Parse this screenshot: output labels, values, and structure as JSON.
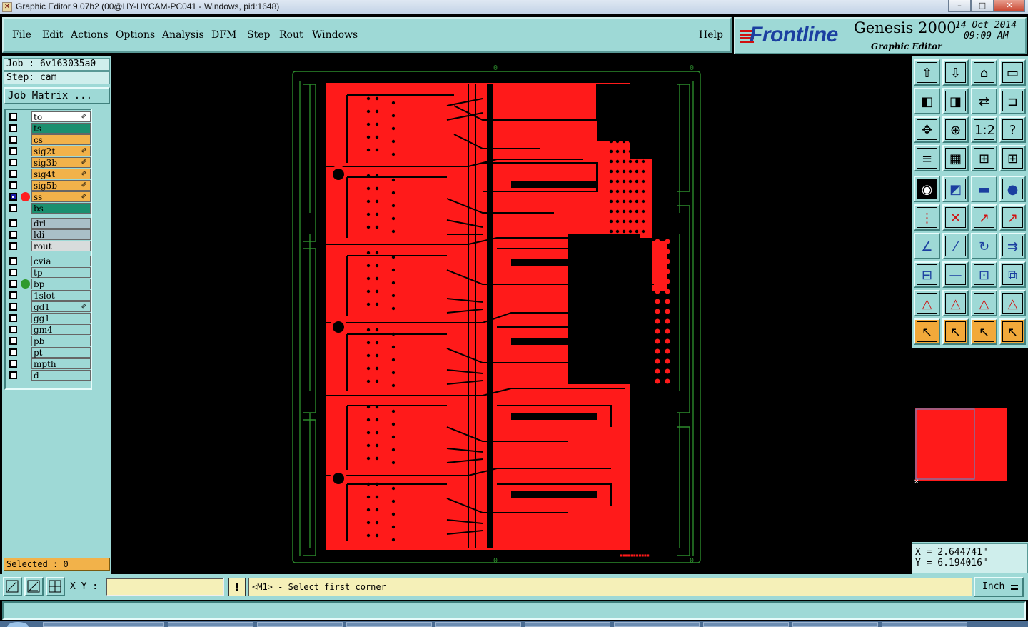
{
  "window": {
    "title": "Graphic Editor 9.07b2 (00@HY-HYCAM-PC041 - Windows, pid:1648)",
    "app_icon": "x-icon",
    "controls": {
      "minimize": "–",
      "maximize": "□",
      "close": "✕"
    }
  },
  "menu": {
    "items": [
      "File",
      "Edit",
      "Actions",
      "Options",
      "Analysis",
      "DFM",
      "Step",
      "Rout",
      "Windows"
    ],
    "help": "Help"
  },
  "brand": {
    "logo": "Frontline",
    "product": "Genesis 2000",
    "subtitle": "Graphic Editor",
    "date": "14 Oct 2014",
    "time": "09:09 AM"
  },
  "job": {
    "job_label": "Job : 6v163035a0",
    "step_label": "Step: cam",
    "matrix_button": "Job Matrix ..."
  },
  "layers": [
    {
      "name": "to",
      "color": "#ffffff",
      "mark": "✐"
    },
    {
      "name": "ts",
      "color": "#1b8f6f",
      "mark": ""
    },
    {
      "name": "cs",
      "color": "#f2b24a",
      "mark": ""
    },
    {
      "name": "sig2t",
      "color": "#f2b24a",
      "mark": "✐"
    },
    {
      "name": "sig3b",
      "color": "#f2b24a",
      "mark": "✐"
    },
    {
      "name": "sig4t",
      "color": "#f2b24a",
      "mark": "✐"
    },
    {
      "name": "sig5b",
      "color": "#f2b24a",
      "mark": "✐"
    },
    {
      "name": "ss",
      "color": "#f2b24a",
      "mark": "✐",
      "active": true,
      "display_color": "#ff2020"
    },
    {
      "name": "bs",
      "color": "#1b8f6f",
      "mark": ""
    },
    {
      "name": "drl",
      "color": "#a9bfc7",
      "mark": ""
    },
    {
      "name": "ldi",
      "color": "#a9bfc7",
      "mark": ""
    },
    {
      "name": "rout",
      "color": "#d8dcdc",
      "mark": ""
    },
    {
      "name": "cvia",
      "color": "#9ed9d6",
      "mark": ""
    },
    {
      "name": "tp",
      "color": "#9ed9d6",
      "mark": ""
    },
    {
      "name": "bp",
      "color": "#9ed9d6",
      "mark": "",
      "display_color": "#2e9a2e"
    },
    {
      "name": "1slot",
      "color": "#9ed9d6",
      "mark": ""
    },
    {
      "name": "gd1",
      "color": "#9ed9d6",
      "mark": "✐"
    },
    {
      "name": "gg1",
      "color": "#9ed9d6",
      "mark": ""
    },
    {
      "name": "gm4",
      "color": "#9ed9d6",
      "mark": ""
    },
    {
      "name": "pb",
      "color": "#9ed9d6",
      "mark": ""
    },
    {
      "name": "pt",
      "color": "#9ed9d6",
      "mark": ""
    },
    {
      "name": "mpth",
      "color": "#9ed9d6",
      "mark": ""
    },
    {
      "name": "d",
      "color": "#9ed9d6",
      "mark": ""
    }
  ],
  "selected": "Selected : 0",
  "coords": {
    "x": "X = 2.644741\"",
    "y": "Y = 6.194016\""
  },
  "bottom": {
    "xy_label": "X Y :",
    "xy_value": "",
    "excl": "!",
    "prompt": "<M1> - Select first corner",
    "unit": "Inch"
  },
  "canvas": {
    "board_color": "#ff1a1a",
    "outline_color": "#2c8a2c",
    "corner_marks": [
      "0",
      "0",
      "0",
      "0",
      "0"
    ]
  },
  "tools": [
    "zoom-home-icon",
    "zoom-back-icon",
    "home-icon",
    "window-icon",
    "pan-left-icon",
    "pan-right-icon",
    "mirror-icon",
    "snap-icon",
    "fit-icon",
    "center-icon",
    "scale-1-2-icon",
    "help-icon",
    "measure-icon",
    "grid-icon",
    "layer-display-icon",
    "layer-display-2-icon",
    "pad-icon",
    "line-icon",
    "ruler-icon",
    "circle-icon",
    "node-icon",
    "cross-icon",
    "point-icon",
    "point-2-icon",
    "angle-icon",
    "slant-icon",
    "arc-icon",
    "align-icon",
    "break-icon",
    "segment-icon",
    "resize-icon",
    "copy-icon",
    "triangle-icon",
    "triangle-2-icon",
    "triangle-3-icon",
    "triangle-4-icon",
    "select-icon",
    "select-box-icon",
    "select-circle-icon",
    "select-route-icon"
  ]
}
